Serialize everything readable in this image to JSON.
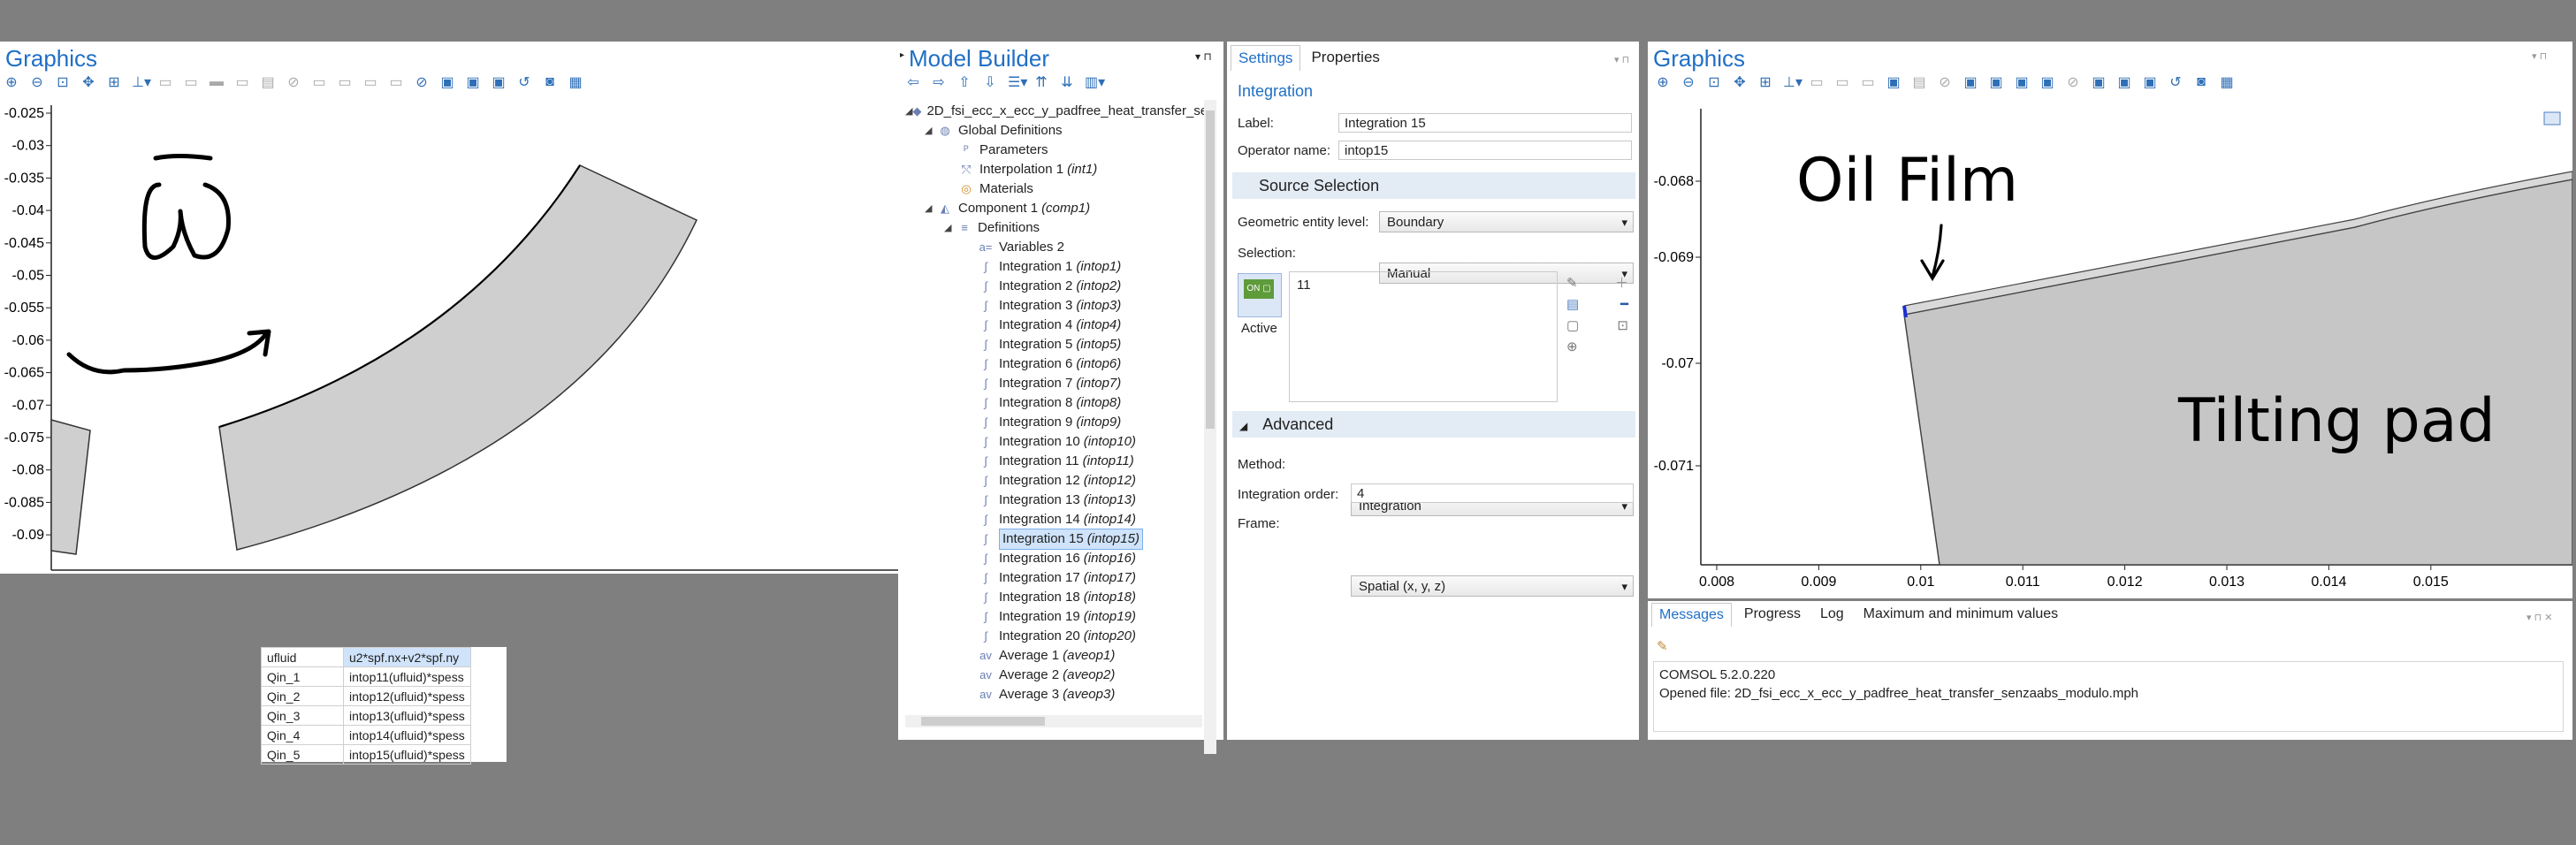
{
  "left_graphics": {
    "title": "Graphics",
    "y_ticks": [
      "-0.025",
      "-0.03",
      "-0.035",
      "-0.04",
      "-0.045",
      "-0.05",
      "-0.055",
      "-0.06",
      "-0.065",
      "-0.07",
      "-0.075",
      "-0.08",
      "-0.085",
      "-0.09"
    ]
  },
  "model_builder": {
    "title": "Model Builder",
    "root": "2D_fsi_ecc_x_ecc_y_padfree_heat_transfer_se",
    "global_definitions": "Global Definitions",
    "parameters": "Parameters",
    "interpolation": {
      "label": "Interpolation 1",
      "tag": "(int1)"
    },
    "materials": "Materials",
    "component": {
      "label": "Component 1",
      "tag": "(comp1)"
    },
    "definitions": "Definitions",
    "variables": "Variables 2",
    "integrations": [
      {
        "label": "Integration 1",
        "tag": "(intop1)"
      },
      {
        "label": "Integration 2",
        "tag": "(intop2)"
      },
      {
        "label": "Integration 3",
        "tag": "(intop3)"
      },
      {
        "label": "Integration 4",
        "tag": "(intop4)"
      },
      {
        "label": "Integration 5",
        "tag": "(intop5)"
      },
      {
        "label": "Integration 6",
        "tag": "(intop6)"
      },
      {
        "label": "Integration 7",
        "tag": "(intop7)"
      },
      {
        "label": "Integration 8",
        "tag": "(intop8)"
      },
      {
        "label": "Integration 9",
        "tag": "(intop9)"
      },
      {
        "label": "Integration 10",
        "tag": "(intop10)"
      },
      {
        "label": "Integration 11",
        "tag": "(intop11)"
      },
      {
        "label": "Integration 12",
        "tag": "(intop12)"
      },
      {
        "label": "Integration 13",
        "tag": "(intop13)"
      },
      {
        "label": "Integration 14",
        "tag": "(intop14)"
      },
      {
        "label": "Integration 15",
        "tag": "(intop15)"
      },
      {
        "label": "Integration 16",
        "tag": "(intop16)"
      },
      {
        "label": "Integration 17",
        "tag": "(intop17)"
      },
      {
        "label": "Integration 18",
        "tag": "(intop18)"
      },
      {
        "label": "Integration 19",
        "tag": "(intop19)"
      },
      {
        "label": "Integration 20",
        "tag": "(intop20)"
      }
    ],
    "averages": [
      {
        "label": "Average 1",
        "tag": "(aveop1)"
      },
      {
        "label": "Average 2",
        "tag": "(aveop2)"
      },
      {
        "label": "Average 3",
        "tag": "(aveop3)"
      }
    ]
  },
  "settings": {
    "tab_settings": "Settings",
    "tab_properties": "Properties",
    "heading": "Integration",
    "label_caption": "Label:",
    "label_value": "Integration 15",
    "opname_caption": "Operator name:",
    "opname_value": "intop15",
    "source_selection": "Source Selection",
    "geom_level_caption": "Geometric entity level:",
    "geom_level_value": "Boundary",
    "selection_caption": "Selection:",
    "selection_value": "Manual",
    "selection_list_item": "11",
    "active_label": "Active",
    "advanced": "Advanced",
    "method_caption": "Method:",
    "method_value": "Integration",
    "order_caption": "Integration order:",
    "order_value": "4",
    "frame_caption": "Frame:",
    "frame_value": "Spatial  (x, y, z)"
  },
  "right_graphics": {
    "title": "Graphics",
    "y_ticks": [
      "-0.068",
      "-0.069",
      "-0.07",
      "-0.071"
    ],
    "x_ticks": [
      "0.008",
      "0.009",
      "0.01",
      "0.011",
      "0.012",
      "0.013",
      "0.014",
      "0.015"
    ],
    "annotation_oil": "Oil Film",
    "annotation_pad": "Tilting pad"
  },
  "messages": {
    "tabs": [
      "Messages",
      "Progress",
      "Log",
      "Maximum and minimum values"
    ],
    "lines": [
      "COMSOL 5.2.0.220",
      "Opened file: 2D_fsi_ecc_x_ecc_y_padfree_heat_transfer_senzaabs_modulo.mph"
    ]
  },
  "variables_table": [
    {
      "name": "ufluid",
      "expr": "u2*spf.nx+v2*spf.ny"
    },
    {
      "name": "Qin_1",
      "expr": "intop11(ufluid)*spess"
    },
    {
      "name": "Qin_2",
      "expr": "intop12(ufluid)*spess"
    },
    {
      "name": "Qin_3",
      "expr": "intop13(ufluid)*spess"
    },
    {
      "name": "Qin_4",
      "expr": "intop14(ufluid)*spess"
    },
    {
      "name": "Qin_5",
      "expr": "intop15(ufluid)*spess"
    }
  ],
  "colors": {
    "accent": "#1f6fc5",
    "geometry_fill": "#cfcfcf",
    "selection": "#cfe3fa",
    "background": "#7f7f7f"
  }
}
